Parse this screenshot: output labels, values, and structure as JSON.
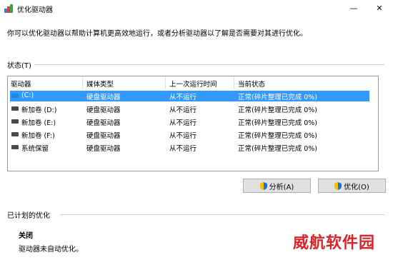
{
  "window": {
    "title": "优化驱动器",
    "minimize_glyph": "—",
    "close_glyph": "✕"
  },
  "intro_text": "你可以优化驱动器以帮助计算机更高效地运行，或者分析驱动器以了解是否需要对其进行优化。",
  "status": {
    "section_label": "状态(T)",
    "columns": [
      "驱动器",
      "媒体类型",
      "上一次运行时间",
      "当前状态"
    ],
    "rows": [
      {
        "drive": "(C:)",
        "media": "硬盘驱动器",
        "last_run": "从不运行",
        "status": "正常(碎片整理已完成 0%)",
        "selected": true,
        "icon": "windows-drive-icon"
      },
      {
        "drive": "新加卷 (D:)",
        "media": "硬盘驱动器",
        "last_run": "从不运行",
        "status": "正常(碎片整理已完成 0%)",
        "selected": false,
        "icon": "drive-icon"
      },
      {
        "drive": "新加卷 (E:)",
        "media": "硬盘驱动器",
        "last_run": "从不运行",
        "status": "正常(碎片整理已完成 0%)",
        "selected": false,
        "icon": "drive-icon"
      },
      {
        "drive": "新加卷 (F:)",
        "media": "硬盘驱动器",
        "last_run": "从不运行",
        "status": "正常(碎片整理已完成 0%)",
        "selected": false,
        "icon": "drive-icon"
      },
      {
        "drive": "系统保留",
        "media": "硬盘驱动器",
        "last_run": "从不运行",
        "status": "正常(碎片整理已完成 0%)",
        "selected": false,
        "icon": "drive-icon"
      }
    ]
  },
  "buttons": {
    "analyze": "分析(A)",
    "optimize": "优化(O)"
  },
  "scheduled": {
    "section_label": "已计划的优化",
    "state": "关闭",
    "description": "驱动器未自动优化。"
  },
  "watermark": "威航软件园",
  "colors": {
    "selection": "#3399ff",
    "watermark": "#d9252a",
    "shield_blue": "#1e6fd9",
    "shield_yellow": "#f5c400"
  }
}
